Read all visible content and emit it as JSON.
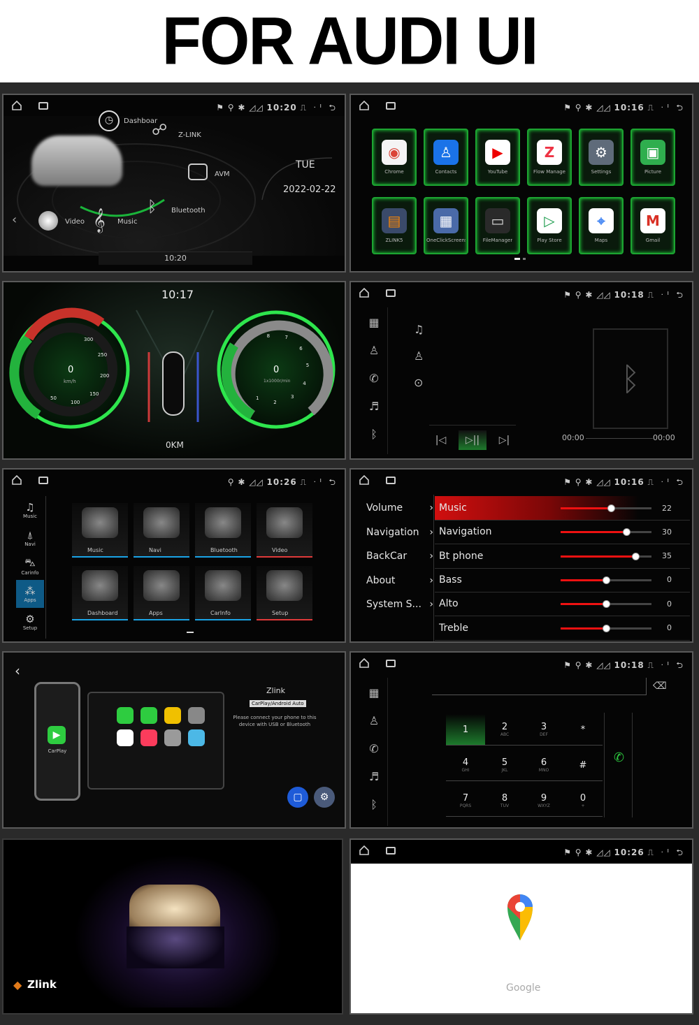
{
  "header": {
    "title": "FOR AUDI UI"
  },
  "status": {
    "p1": "10:20",
    "p2": "10:16",
    "p4": "10:18",
    "p5": "10:26",
    "p6": "10:16",
    "p8": "10:18",
    "p10": "10:26"
  },
  "home": {
    "menu": {
      "dashboard": "Dashboar",
      "zlink": "Z-LINK",
      "avm": "AVM",
      "bluetooth": "Bluetooth",
      "music": "Music",
      "video": "Video"
    },
    "day": "TUE",
    "date": "2022-02-22",
    "clock": "10:20"
  },
  "apps": {
    "items": [
      {
        "label": "Chrome",
        "icon": "chrome-icon",
        "color": "#f4f4f4"
      },
      {
        "label": "Contacts",
        "icon": "contacts-icon",
        "color": "#1a73e8"
      },
      {
        "label": "YouTube",
        "icon": "youtube-icon",
        "color": "#ffffff"
      },
      {
        "label": "Flow Manage",
        "icon": "zlink-icon",
        "color": "#ffffff"
      },
      {
        "label": "Settings",
        "icon": "settings-icon",
        "color": "#5f6b7a"
      },
      {
        "label": "Picture",
        "icon": "picture-icon",
        "color": "#2fae4e"
      },
      {
        "label": "ZLINK5",
        "icon": "zlink5-icon",
        "color": "#3a4a6a"
      },
      {
        "label": "OneClickScreensh",
        "icon": "screenshot-icon",
        "color": "#4a6aa8"
      },
      {
        "label": "FileManager",
        "icon": "file-manager-icon",
        "color": "#2a2a2a"
      },
      {
        "label": "Play Store",
        "icon": "play-store-icon",
        "color": "#ffffff"
      },
      {
        "label": "Maps",
        "icon": "maps-icon",
        "color": "#ffffff"
      },
      {
        "label": "Gmail",
        "icon": "gmail-icon",
        "color": "#ffffff"
      }
    ]
  },
  "cluster": {
    "time": "10:17",
    "speed": "0",
    "speed_unit": "km/h",
    "rpm": "0",
    "rpm_unit": "1x1000r/min",
    "odo": "0KM",
    "speed_ticks": [
      "50",
      "100",
      "150",
      "200",
      "250",
      "300"
    ],
    "rpm_ticks": [
      "1",
      "2",
      "3",
      "4",
      "5",
      "6",
      "7",
      "8"
    ]
  },
  "bt_music": {
    "time_start": "00:00",
    "time_end": "00:00"
  },
  "launcher": {
    "sidebar": [
      "Music",
      "Navi",
      "Carinfo",
      "Apps",
      "Setup"
    ],
    "tiles": [
      "Music",
      "Navi",
      "Bluetooth",
      "Video",
      "Dashboard",
      "Apps",
      "CarInfo",
      "Setup"
    ]
  },
  "sound": {
    "menu": [
      "Volume",
      "Navigation",
      "BackCar",
      "About",
      "System S..."
    ],
    "rows": [
      {
        "name": "Music",
        "value": "22",
        "level": 0.55
      },
      {
        "name": "Navigation",
        "value": "30",
        "level": 0.72
      },
      {
        "name": "Bt phone",
        "value": "35",
        "level": 0.82
      },
      {
        "name": "Bass",
        "value": "0",
        "level": 0.5
      },
      {
        "name": "Alto",
        "value": "0",
        "level": 0.5
      },
      {
        "name": "Treble",
        "value": "0",
        "level": 0.5
      }
    ]
  },
  "zlink": {
    "title": "Zlink",
    "subtitle": "CarPlay/Android Auto",
    "message": "Please connect your phone to this device with USB or Bluetooth",
    "carplay": "CarPlay"
  },
  "dialer": {
    "keys": [
      {
        "d": "1",
        "s": ""
      },
      {
        "d": "2",
        "s": "ABC"
      },
      {
        "d": "3",
        "s": "DEF"
      },
      {
        "d": "*",
        "s": ""
      },
      {
        "d": "4",
        "s": "GHI"
      },
      {
        "d": "5",
        "s": "JKL"
      },
      {
        "d": "6",
        "s": "MNO"
      },
      {
        "d": "#",
        "s": ""
      },
      {
        "d": "7",
        "s": "PQRS"
      },
      {
        "d": "8",
        "s": "TUV"
      },
      {
        "d": "9",
        "s": "WXYZ"
      },
      {
        "d": "0",
        "s": "+"
      }
    ]
  },
  "splash": {
    "brand": "Zlink"
  },
  "google": {
    "label": "Google"
  }
}
